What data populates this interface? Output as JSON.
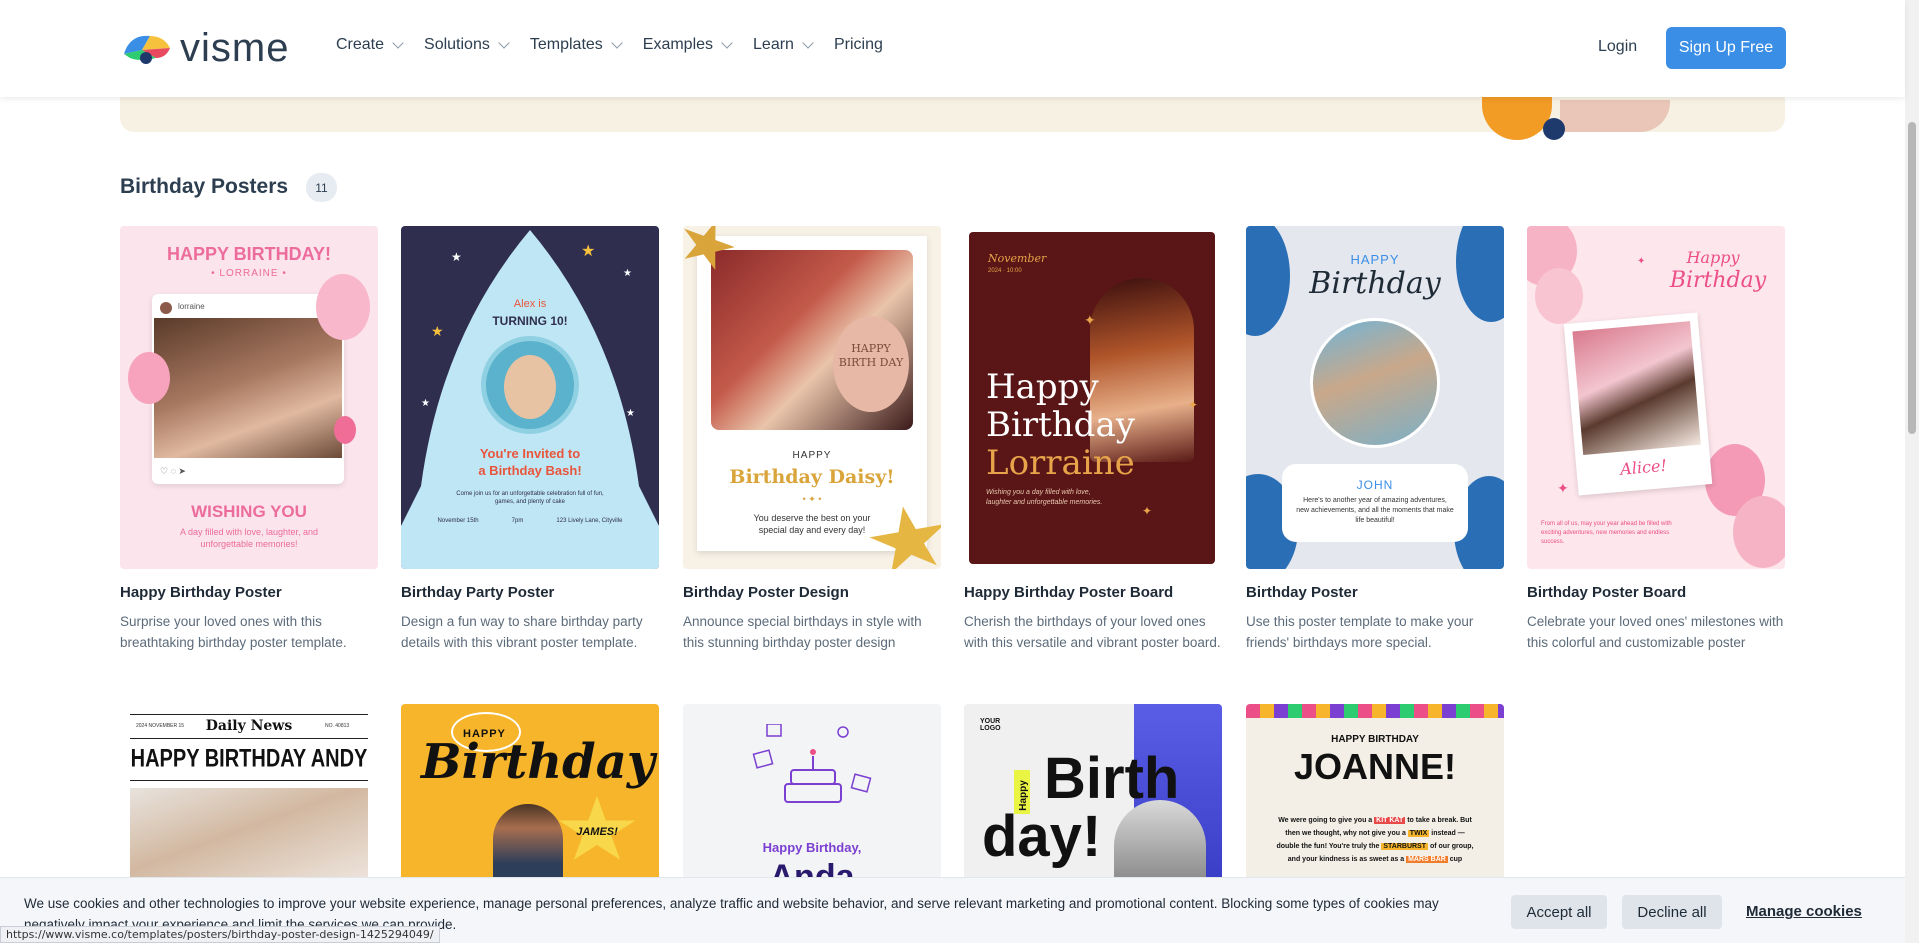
{
  "header": {
    "logo_text": "visme",
    "nav": [
      {
        "label": "Create",
        "has_dropdown": true
      },
      {
        "label": "Solutions",
        "has_dropdown": true
      },
      {
        "label": "Templates",
        "has_dropdown": true
      },
      {
        "label": "Examples",
        "has_dropdown": true
      },
      {
        "label": "Learn",
        "has_dropdown": true
      },
      {
        "label": "Pricing",
        "has_dropdown": false
      }
    ],
    "login": "Login",
    "signup": "Sign Up Free"
  },
  "section": {
    "title": "Birthday Posters",
    "count": "11"
  },
  "cards": [
    {
      "title": "Happy Birthday Poster",
      "desc": "Surprise your loved ones with this breathtaking birthday poster template.",
      "poster": {
        "heading": "HAPPY BIRTHDAY!",
        "name": "• LORRAINE •",
        "user": "lorraine",
        "footer": "WISHING YOU",
        "sub": "A day filled with love, laughter, and unforgettable memories!"
      }
    },
    {
      "title": "Birthday Party Poster",
      "desc": "Design a fun way to share birthday party details with this vibrant poster template.",
      "poster": {
        "line1": "Alex is",
        "line2": "TURNING 10!",
        "invite1": "You're Invited to",
        "invite2": "a Birthday Bash!",
        "small": "Come join us for an unforgettable celebration full of fun, games, and plenty of cake",
        "info1": "November 15th",
        "info2": "7pm",
        "info3": "123 Lively Lane, Cityville"
      }
    },
    {
      "title": "Birthday Poster Design",
      "desc": "Announce special birthdays in style with this stunning birthday poster design template.",
      "poster": {
        "balloon": "HAPPY BIRTH DAY",
        "happy": "HAPPY",
        "name": "Birthday Daisy!",
        "stars": "• ✦ •",
        "sub": "You deserve the best on your special day and every day!"
      }
    },
    {
      "title": "Happy Birthday Poster Board",
      "desc": "Cherish the birthdays of your loved ones with this versatile and vibrant poster board.",
      "poster": {
        "date": "November",
        "date2": "2024 · 10:00",
        "l1": "Happy",
        "l2": "Birthday",
        "l3": "Lorraine",
        "sub": "Wishing you a day filled with love, laughter and unforgettable memories."
      }
    },
    {
      "title": "Birthday Poster",
      "desc": "Use this poster template to make your friends' birthdays more special.",
      "poster": {
        "happy": "HAPPY",
        "birthday": "Birthday",
        "name": "JOHN",
        "sub": "Here's to another year of amazing adventures, new achievements, and all the moments that make life beautiful!"
      }
    },
    {
      "title": "Birthday Poster Board",
      "desc": "Celebrate your loved ones' milestones with this colorful and customizable poster board.",
      "poster": {
        "happy": "Happy",
        "birthday": "Birthday",
        "name": "Alice!",
        "sub": "From all of us, may your year ahead be filled with exciting adventures, new memories and endless success."
      }
    },
    {
      "poster": {
        "paper": "Daily News",
        "date": "2024 NOVEMBER 15",
        "edition": "NO. 40813",
        "headline": "HAPPY BIRTHDAY ANDY"
      }
    },
    {
      "poster": {
        "happy": "HAPPY",
        "birthday": "Birthday",
        "name": "JAMES!"
      }
    },
    {
      "poster": {
        "greeting": "Happy Birthday,",
        "name": "Anda"
      }
    },
    {
      "poster": {
        "logo": "YOUR LOGO",
        "happy": "Happy",
        "birth": "Birth",
        "day": "day!"
      }
    },
    {
      "poster": {
        "hb": "HAPPY BIRTHDAY",
        "name": "JOANNE!",
        "p1": "We were going to give you a",
        "kit": "KIT KAT",
        "p2": "to take a break. But then we thought, why not give you a",
        "twix": "TWIX",
        "p3": "instead — double the fun!",
        "p4": "You're truly the",
        "star": "STARBURST",
        "p5": "of our group,",
        "p6": "and your kindness is as sweet as a",
        "mars": "MARS BAR",
        "p7": "cup"
      }
    }
  ],
  "cookie": {
    "text": "We use cookies and other technologies to improve your website experience, manage personal preferences, analyze traffic and website behavior, and serve relevant marketing and promotional content. Blocking some types of cookies may negatively impact your experience and limit the services we can provide.",
    "accept": "Accept all",
    "decline": "Decline all",
    "manage": "Manage cookies"
  },
  "status_url": "https://www.visme.co/templates/posters/birthday-poster-design-1425294049/",
  "colors": {
    "primary": "#3a8ee6",
    "text_dark": "#1f2a37",
    "banner": "#f6f1e3"
  }
}
